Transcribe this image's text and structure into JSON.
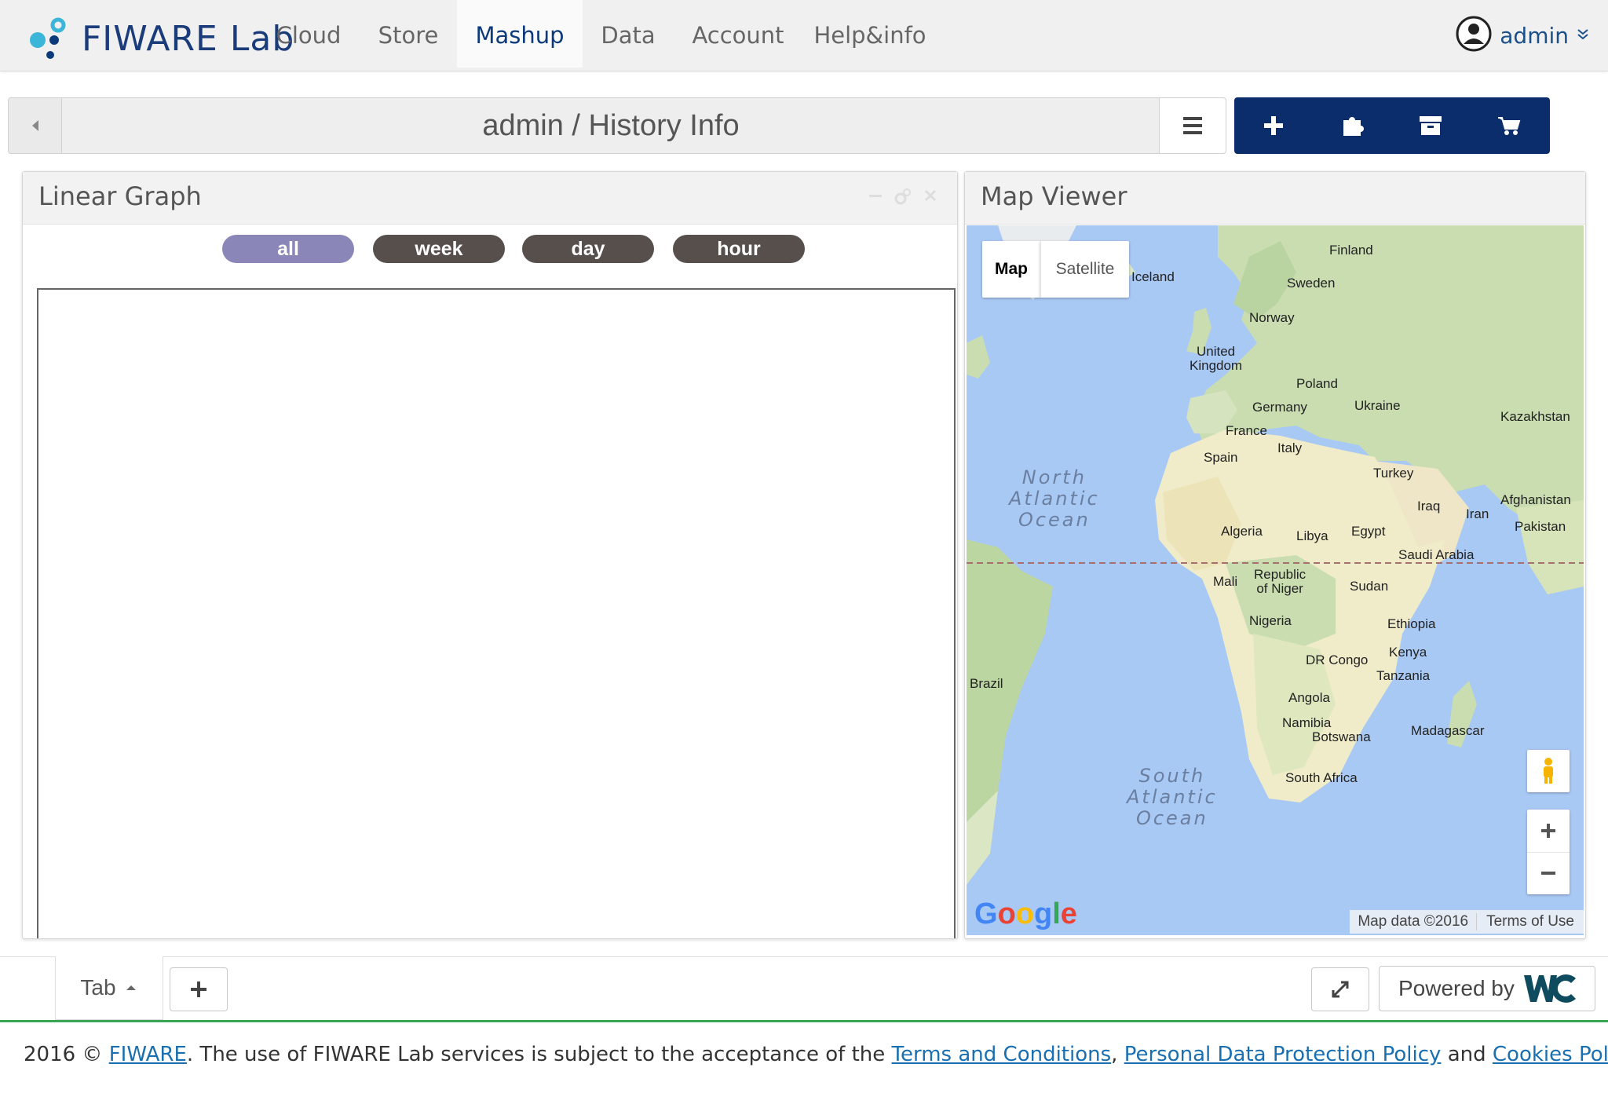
{
  "nav": {
    "brand": "FIWARE Lab",
    "items": [
      "Cloud",
      "Store",
      "Mashup",
      "Data",
      "Account",
      "Help&info"
    ],
    "active": "Mashup",
    "user": "admin"
  },
  "header": {
    "path": "admin / History Info",
    "action_icons": [
      "plus-icon",
      "puzzle-icon",
      "archive-icon",
      "cart-icon"
    ]
  },
  "widgets": {
    "linear_graph": {
      "title": "Linear Graph",
      "ranges": [
        "all",
        "week",
        "day",
        "hour"
      ],
      "selected_range": "all"
    },
    "map_viewer": {
      "title": "Map Viewer",
      "map_type_buttons": [
        "Map",
        "Satellite"
      ],
      "selected_map_type": "Map",
      "labels": {
        "finland": "Finland",
        "iceland": "Iceland",
        "sweden": "Sweden",
        "norway": "Norway",
        "uk": "United\nKingdom",
        "poland": "Poland",
        "germany": "Germany",
        "ukraine": "Ukraine",
        "kazakhstan": "Kazakhstan",
        "france": "France",
        "italy": "Italy",
        "spain": "Spain",
        "turkey": "Turkey",
        "iraq": "Iraq",
        "iran": "Iran",
        "afghanistan": "Afghanistan",
        "pakistan": "Pakistan",
        "algeria": "Algeria",
        "libya": "Libya",
        "egypt": "Egypt",
        "saudi": "Saudi Arabia",
        "mali": "Mali",
        "niger": "Republic\nof Niger",
        "sudan": "Sudan",
        "nigeria": "Nigeria",
        "ethiopia": "Ethiopia",
        "kenya": "Kenya",
        "drc": "DR Congo",
        "tanzania": "Tanzania",
        "brazil": "Brazil",
        "angola": "Angola",
        "namibia": "Namibia",
        "botswana": "Botswana",
        "madagascar": "Madagascar",
        "south_africa": "South Africa",
        "north_atlantic": "North\nAtlantic\nOcean",
        "south_atlantic": "South\nAtlantic\nOcean"
      },
      "attribution": "Map data ©2016",
      "terms": "Terms of Use",
      "logo": "Google"
    }
  },
  "tabs": {
    "current": "Tab",
    "powered_by": "Powered by"
  },
  "footer": {
    "prefix": "2016 © ",
    "fiware": "FIWARE",
    "middle": ". The use of FIWARE Lab services is subject to the acceptance of the ",
    "terms": "Terms and Conditions",
    "comma": ", ",
    "privacy": "Personal Data Protection Policy",
    "and": " and ",
    "cookies": "Cookies Policy",
    "end": "."
  },
  "colors": {
    "nav_active": "#0d3a7a",
    "action_bar": "#0b2d6b",
    "pill_selected": "#8a86b8",
    "pill": "#574f4c",
    "footer_line": "#3aa655"
  }
}
